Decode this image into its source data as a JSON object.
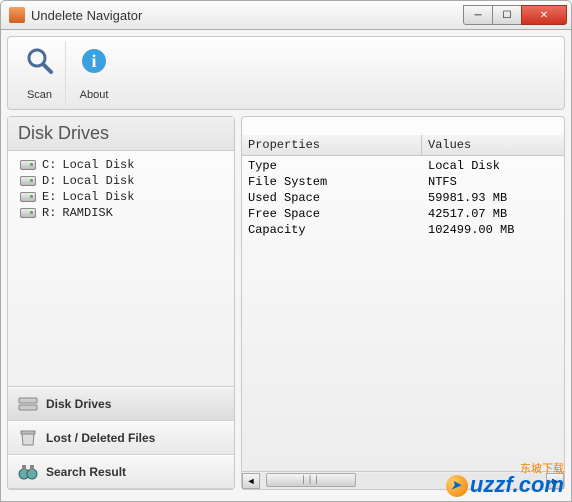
{
  "window": {
    "title": "Undelete Navigator"
  },
  "toolbar": {
    "scan": "Scan",
    "about": "About"
  },
  "left": {
    "header": "Disk Drives",
    "drives": [
      {
        "letter": "C:",
        "label": "Local Disk"
      },
      {
        "letter": "D:",
        "label": "Local Disk"
      },
      {
        "letter": "E:",
        "label": "Local Disk"
      },
      {
        "letter": "R:",
        "label": "RAMDISK"
      }
    ],
    "nav": {
      "disk_drives": "Disk Drives",
      "lost_deleted": "Lost / Deleted Files",
      "search_result": "Search Result"
    }
  },
  "right": {
    "col_properties": "Properties",
    "col_values": "Values",
    "rows": [
      {
        "k": "Type",
        "v": "Local Disk"
      },
      {
        "k": "File System",
        "v": "NTFS"
      },
      {
        "k": "Used Space",
        "v": "59981.93 MB"
      },
      {
        "k": "Free Space",
        "v": "42517.07 MB"
      },
      {
        "k": "Capacity",
        "v": "102499.00 MB"
      }
    ]
  },
  "watermark": {
    "sub": "东坡下载",
    "main": "uzzf.com"
  }
}
